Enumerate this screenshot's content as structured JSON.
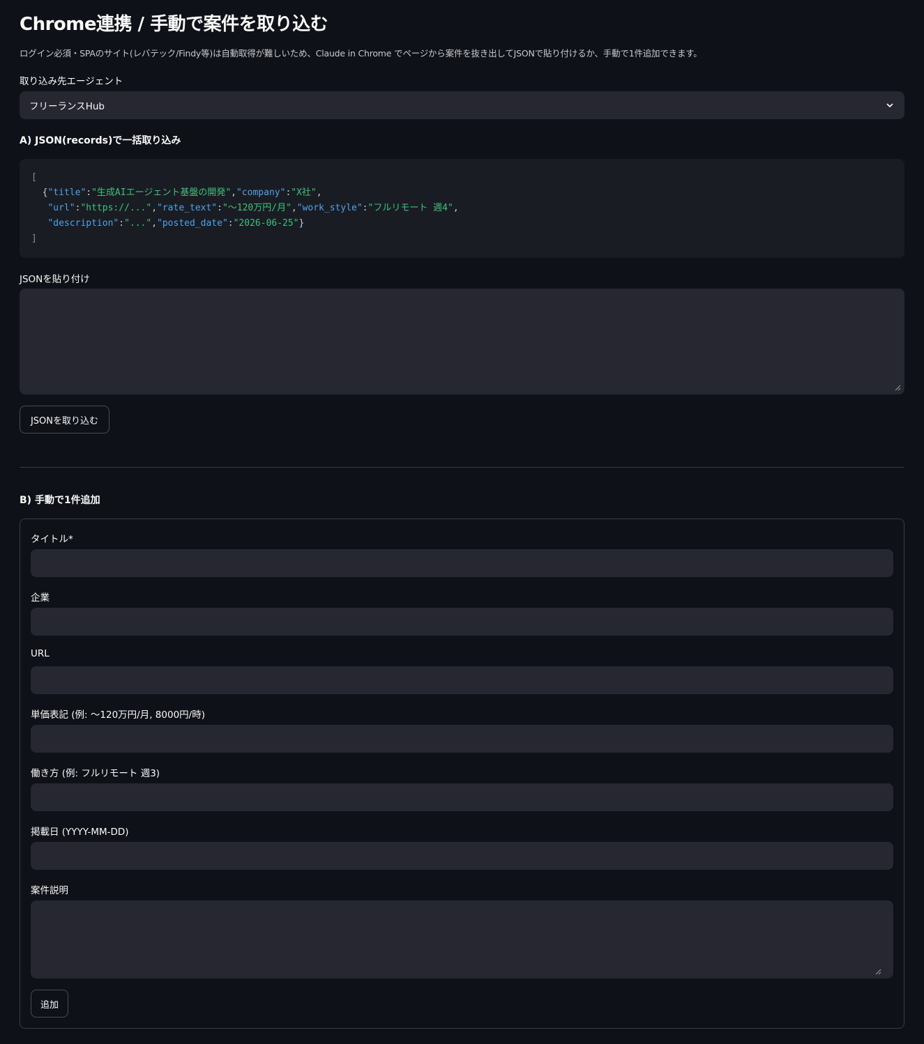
{
  "page": {
    "title": "Chrome連携 / 手動で案件を取り込む",
    "caption": "ログイン必須・SPAのサイト(レバテック/Findy等)は自動取得が難しいため、Claude in Chrome でページから案件を抜き出してJSONで貼り付けるか、手動で1件追加できます。"
  },
  "agent_select": {
    "label": "取り込み先エージェント",
    "value": "フリーランスHub",
    "icon": "chevron-down-icon"
  },
  "section_a": {
    "heading": "A) JSON(records)で一括取り込み",
    "code_sample": {
      "open_bracket": "[",
      "close_bracket": "]",
      "line1": [
        {
          "t": "{",
          "k": "pun"
        },
        {
          "t": "\"title\"",
          "k": "key"
        },
        {
          "t": ":",
          "k": "pun"
        },
        {
          "t": "\"生成AIエージェント基盤の開発\"",
          "k": "str"
        },
        {
          "t": ",",
          "k": "pun"
        },
        {
          "t": "\"company\"",
          "k": "key"
        },
        {
          "t": ":",
          "k": "pun"
        },
        {
          "t": "\"X社\"",
          "k": "str"
        },
        {
          "t": ",",
          "k": "pun"
        }
      ],
      "line2": [
        {
          "t": "\"url\"",
          "k": "key"
        },
        {
          "t": ":",
          "k": "pun"
        },
        {
          "t": "\"https://...\"",
          "k": "str"
        },
        {
          "t": ",",
          "k": "pun"
        },
        {
          "t": "\"rate_text\"",
          "k": "key"
        },
        {
          "t": ":",
          "k": "pun"
        },
        {
          "t": "\"〜120万円/月\"",
          "k": "str"
        },
        {
          "t": ",",
          "k": "pun"
        },
        {
          "t": "\"work_style\"",
          "k": "key"
        },
        {
          "t": ":",
          "k": "pun"
        },
        {
          "t": "\"フルリモート 週4\"",
          "k": "str"
        },
        {
          "t": ",",
          "k": "pun"
        }
      ],
      "line3": [
        {
          "t": "\"description\"",
          "k": "key"
        },
        {
          "t": ":",
          "k": "pun"
        },
        {
          "t": "\"...\"",
          "k": "str"
        },
        {
          "t": ",",
          "k": "pun"
        },
        {
          "t": "\"posted_date\"",
          "k": "key"
        },
        {
          "t": ":",
          "k": "pun"
        },
        {
          "t": "\"2026-06-25\"",
          "k": "str"
        },
        {
          "t": "}",
          "k": "pun"
        }
      ]
    },
    "paste_label": "JSONを貼り付け",
    "paste_value": "",
    "import_button": "JSONを取り込む"
  },
  "section_b": {
    "heading": "B) 手動で1件追加",
    "fields": {
      "title_label": "タイトル*",
      "company_label": "企業",
      "url_label": "URL",
      "rate_label": "単価表記 (例: 〜120万円/月, 8000円/時)",
      "work_style_label": "働き方 (例: フルリモート 週3)",
      "posted_date_label": "掲載日 (YYYY-MM-DD)",
      "description_label": "案件説明"
    },
    "add_button": "追加"
  },
  "colors": {
    "background": "#0e1117",
    "input_bg": "#262730",
    "code_bg": "#1a1c24",
    "json_key": "#4fa3e8",
    "json_string": "#3cc37a"
  }
}
